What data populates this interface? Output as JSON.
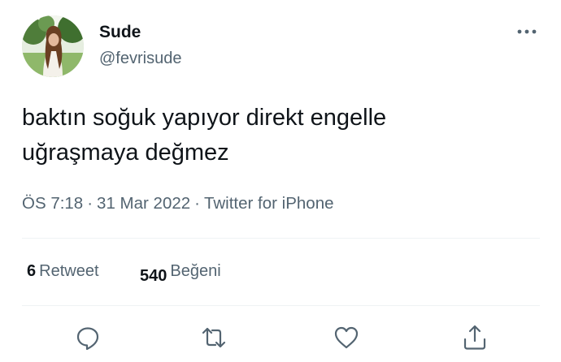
{
  "author": {
    "display_name": "Sude",
    "handle": "@fevrisude",
    "avatar_icon": "user-avatar-photo"
  },
  "tweet": {
    "lines": [
      "baktın soğuk yapıyor direkt engelle",
      "uğraşmaya değmez"
    ]
  },
  "meta": {
    "time": "ÖS 7:18",
    "separator": "·",
    "date": "31 Mar 2022",
    "source": "Twitter for iPhone"
  },
  "stats": {
    "retweets_count": "6",
    "retweets_label": "Retweet",
    "likes_count": "540",
    "likes_label": "Beğeni"
  },
  "actions": [
    "reply-icon",
    "retweet-icon",
    "like-icon",
    "share-icon"
  ],
  "colors": {
    "text_primary": "#0f1419",
    "text_secondary": "#536471",
    "divider": "#eff3f4",
    "icon": "#536471"
  }
}
